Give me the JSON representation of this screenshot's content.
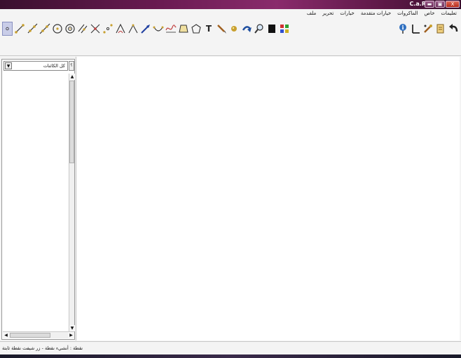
{
  "window": {
    "title": "C.a.R",
    "minimize": "▬",
    "maximize": "▣",
    "close": "X"
  },
  "menu": [
    "ملف",
    "تحرير",
    "خيارات",
    "خيارات متقدمة",
    "الماكروات",
    "خاص",
    "تعليمات"
  ],
  "toolbar": {
    "left_tools": [
      {
        "name": "point-icon",
        "active": true
      },
      {
        "name": "segment-icon"
      },
      {
        "name": "ray-icon"
      },
      {
        "name": "line-icon"
      },
      {
        "name": "circle-icon"
      },
      {
        "name": "circle-three-points-icon"
      },
      {
        "name": "parallel-icon"
      },
      {
        "name": "intersection-icon"
      },
      {
        "name": "midpoint-icon"
      },
      {
        "name": "angle-icon"
      },
      {
        "name": "fixed-angle-icon"
      },
      {
        "name": "vector-icon"
      },
      {
        "name": "arc-icon"
      },
      {
        "name": "function-icon"
      },
      {
        "name": "polygon-icon"
      },
      {
        "name": "conic-icon"
      },
      {
        "name": "text-icon",
        "glyph": "T"
      },
      {
        "name": "pen-icon"
      },
      {
        "name": "ball-icon"
      },
      {
        "name": "undo-arrow-icon"
      },
      {
        "name": "zoom-icon"
      },
      {
        "name": "black-color-icon"
      },
      {
        "name": "color-palette-icon"
      }
    ],
    "right_tools": [
      {
        "name": "info-icon"
      },
      {
        "name": "axis-icon"
      },
      {
        "name": "hide-icon"
      },
      {
        "name": "macro-icon"
      },
      {
        "name": "back-icon"
      }
    ]
  },
  "panel": {
    "combo_value": "كل الكائنات",
    "combo_button": "؟"
  },
  "status": {
    "text": "نقطة : أنشيء نقطة - زر شيفت نقطة ثابتة"
  },
  "colors": {
    "titlebar": "#6a1b52",
    "active_tool": "#c9cde8",
    "canvas": "#ffffff"
  }
}
